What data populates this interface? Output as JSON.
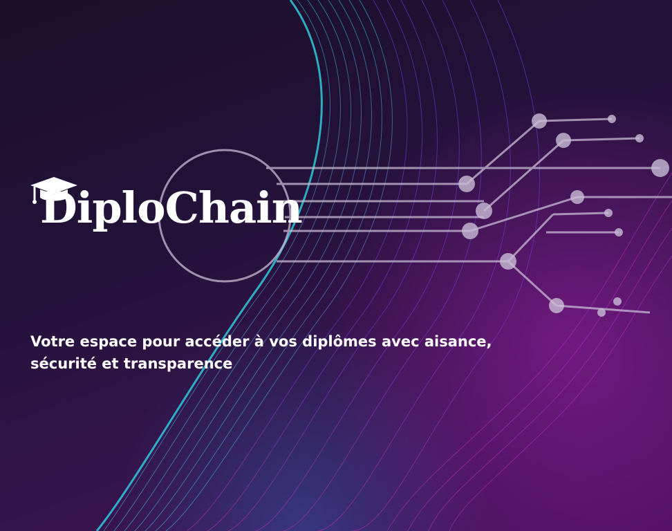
{
  "brand": {
    "name": "DiploChain",
    "logo_icon": "graduation-cap-icon"
  },
  "tagline": {
    "line1": "Votre espace pour accéder à vos diplômes avec aisance,",
    "line2": "sécurité et transparence"
  },
  "colors": {
    "background": "#1f1030",
    "wave_cyan": "#2fd4e6",
    "wave_blue": "#4a5be8",
    "wave_magenta": "#b82fc7",
    "circuit": "#c9bcd6",
    "text": "#ffffff"
  }
}
